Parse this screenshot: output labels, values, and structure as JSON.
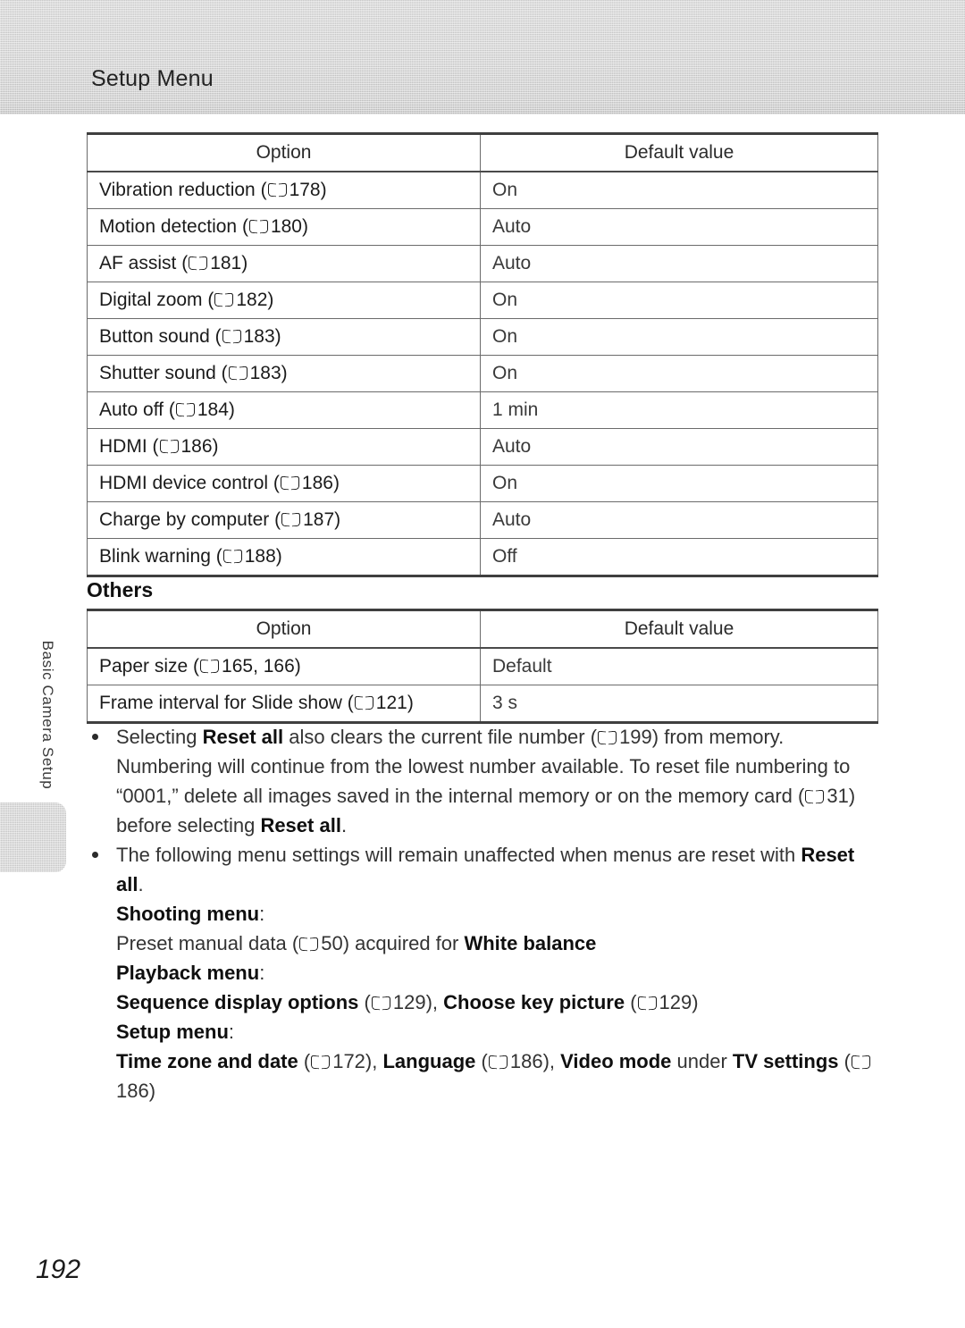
{
  "header": {
    "title": "Setup Menu"
  },
  "side_tab": {
    "label": "Basic Camera Setup"
  },
  "setup_table": {
    "headers": {
      "option": "Option",
      "default": "Default value"
    },
    "rows": [
      {
        "option": "Vibration reduction",
        "ref": "178",
        "value": "On"
      },
      {
        "option": "Motion detection",
        "ref": "180",
        "value": "Auto"
      },
      {
        "option": "AF assist",
        "ref": "181",
        "value": "Auto"
      },
      {
        "option": "Digital zoom",
        "ref": "182",
        "value": "On"
      },
      {
        "option": "Button sound",
        "ref": "183",
        "value": "On"
      },
      {
        "option": "Shutter sound",
        "ref": "183",
        "value": "On"
      },
      {
        "option": "Auto off",
        "ref": "184",
        "value": "1 min"
      },
      {
        "option": "HDMI",
        "ref": "186",
        "value": "Auto"
      },
      {
        "option": "HDMI device control",
        "ref": "186",
        "value": "On"
      },
      {
        "option": "Charge by computer",
        "ref": "187",
        "value": "Auto"
      },
      {
        "option": "Blink warning",
        "ref": "188",
        "value": "Off"
      }
    ]
  },
  "others_section": {
    "heading": "Others",
    "headers": {
      "option": "Option",
      "default": "Default value"
    },
    "rows": [
      {
        "option": "Paper size",
        "ref": "165, 166",
        "value": "Default"
      },
      {
        "option": "Frame interval for Slide show",
        "ref": "121",
        "value": "3 s"
      }
    ]
  },
  "notes": {
    "bullet1": {
      "part1": "Selecting ",
      "bold1": "Reset all",
      "part2": " also clears the current file number (",
      "ref1": "199",
      "part3": ") from memory. Numbering will continue from the lowest number available. To reset file numbering to “0001,” delete all images saved in the internal memory or on the memory card (",
      "ref2": "31",
      "part4": ") before selecting ",
      "bold2": "Reset all",
      "part5": "."
    },
    "bullet2": {
      "part1": "The following menu settings will remain unaffected when menus are reset with ",
      "bold1": "Reset all",
      "part2": "."
    },
    "shooting_menu": {
      "heading": "Shooting menu",
      "colon": ":",
      "line_part1": "Preset manual data (",
      "ref1": "50",
      "line_part2": ") acquired for ",
      "bold1": "White balance"
    },
    "playback_menu": {
      "heading": "Playback menu",
      "colon": ":",
      "bold1": "Sequence display options",
      "part1": " (",
      "ref1": "129",
      "part2": "), ",
      "bold2": "Choose key picture",
      "part3": " (",
      "ref2": "129",
      "part4": ")"
    },
    "setup_menu": {
      "heading": "Setup menu",
      "colon": ":",
      "bold1": "Time zone and date",
      "part1": " (",
      "ref1": "172",
      "part2": "), ",
      "bold2": "Language",
      "part3": " (",
      "ref2": "186",
      "part4": "), ",
      "bold3": "Video mode",
      "part5": " under ",
      "bold4": "TV settings",
      "part6": " (",
      "ref3": "186",
      "part7": ")"
    }
  },
  "page_number": "192"
}
